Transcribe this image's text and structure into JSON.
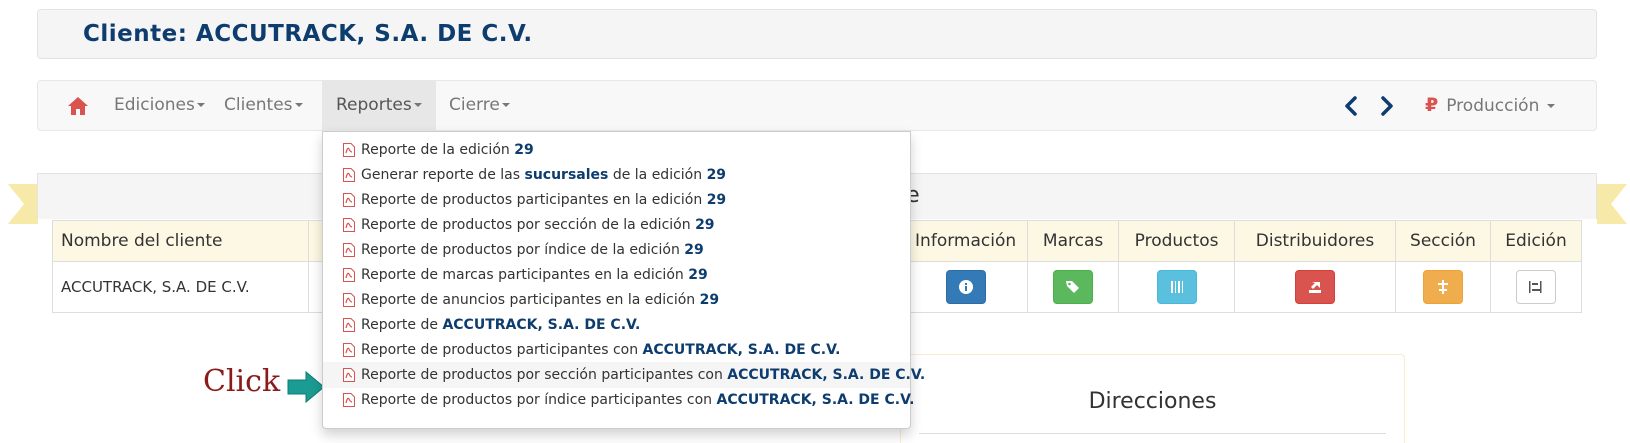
{
  "client_title": "Cliente: ACCUTRACK, S.A. DE C.V.",
  "navbar": {
    "items": [
      {
        "label": "Ediciones"
      },
      {
        "label": "Clientes"
      },
      {
        "label": "Reportes"
      },
      {
        "label": "Cierre"
      }
    ],
    "environment_label": "Producción"
  },
  "panel_heading_fragment": "ente",
  "table": {
    "headers": [
      "Nombre del cliente",
      "Información",
      "Marcas",
      "Productos",
      "Distribuidores",
      "Sección",
      "Edición"
    ],
    "row": {
      "client_name": "ACCUTRACK, S.A. DE C.V."
    }
  },
  "directions_title": "Direcciones",
  "annotation": {
    "click_label": "Click"
  },
  "dropdown": {
    "items": [
      {
        "text": "Reporte de la edición ",
        "bold": "29",
        "suffix": ""
      },
      {
        "text": "Generar reporte de las ",
        "bold": "sucursales",
        "suffix": " de la edición ",
        "bold2": "29"
      },
      {
        "text": "Reporte de productos participantes en la edición ",
        "bold": "29",
        "suffix": ""
      },
      {
        "text": "Reporte de productos por sección de la edición ",
        "bold": "29",
        "suffix": ""
      },
      {
        "text": "Reporte de productos por índice de la edición ",
        "bold": "29",
        "suffix": ""
      },
      {
        "text": "Reporte de marcas participantes en la edición ",
        "bold": "29",
        "suffix": ""
      },
      {
        "text": "Reporte de anuncios participantes en la edición ",
        "bold": "29",
        "suffix": ""
      },
      {
        "text": "Reporte de ",
        "bold": "ACCUTRACK, S.A. DE C.V.",
        "suffix": ""
      },
      {
        "text": "Reporte de productos participantes con ",
        "bold": "ACCUTRACK, S.A. DE C.V.",
        "suffix": ""
      },
      {
        "text": "Reporte de productos por sección participantes con ",
        "bold": "ACCUTRACK, S.A. DE C.V.",
        "suffix": ""
      },
      {
        "text": "Reporte de productos por índice participantes con ",
        "bold": "ACCUTRACK, S.A. DE C.V.",
        "suffix": ""
      }
    ]
  },
  "icons": {
    "home": "home-icon",
    "prev": "chevron-left-icon",
    "next": "chevron-right-icon",
    "environment": "ruble-icon",
    "pdf": "file-pdf-icon",
    "arrow": "arrow-right-icon"
  },
  "colors": {
    "title_text": "#0d3c6e",
    "home_icon": "#d9534f",
    "nav_arrows": "#0d3c6e",
    "table_header_bg": "#fcf8e3",
    "ribbon": "#f7e9a8",
    "click_label": "#8b1a1a",
    "click_arrow": "#1a9c93"
  }
}
